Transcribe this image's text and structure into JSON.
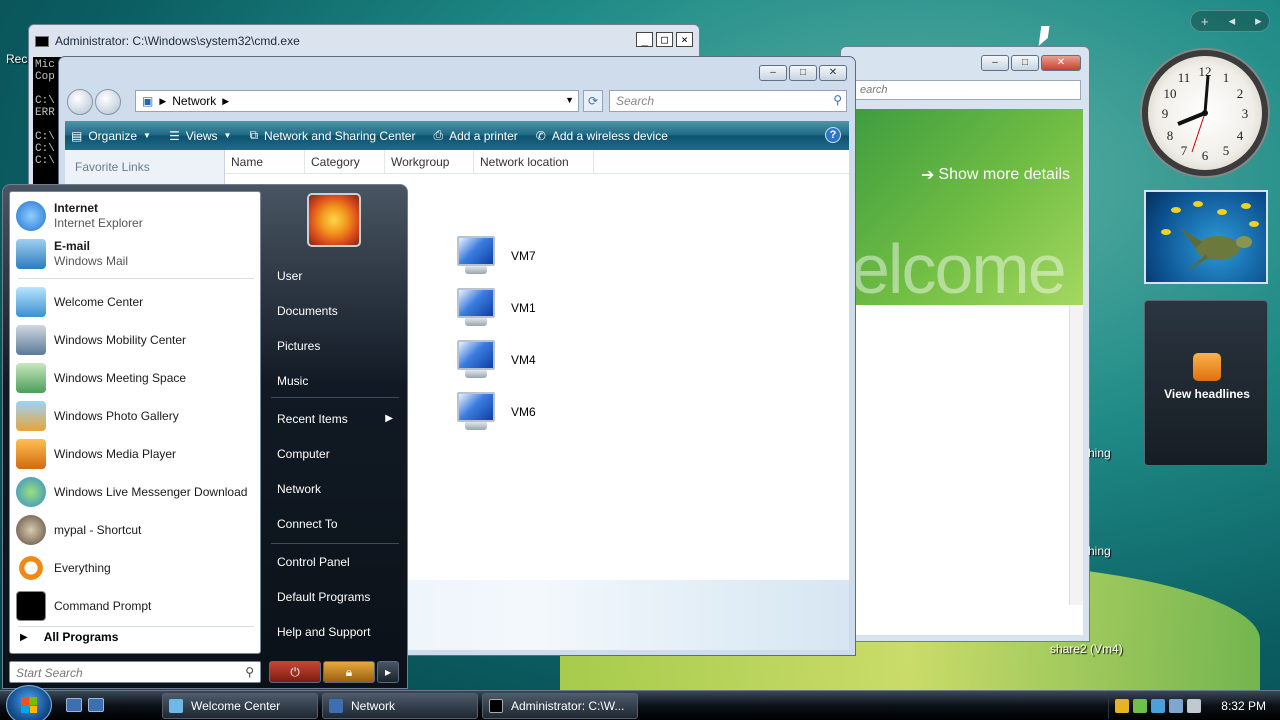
{
  "cmd": {
    "title": "Administrator: C:\\Windows\\system32\\cmd.exe",
    "lines": "Mic\nCop\n\nC:\\\nERR\n\nC:\\\nC:\\\nC:\\",
    "ctrl_min": "_",
    "ctrl_max": "□",
    "ctrl_close": "×"
  },
  "welcome_window": {
    "search_placeholder": "earch",
    "show_more_details": "Show more details",
    "banner_text": "elcome"
  },
  "explorer": {
    "address": "Network",
    "search_placeholder": "Search",
    "commands": [
      "Organize",
      "Views",
      "Network and Sharing Center",
      "Add a printer",
      "Add a wireless device"
    ],
    "help": "?",
    "favorite_links": "Favorite Links",
    "columns": [
      "Name",
      "Category",
      "Workgroup",
      "Network location"
    ],
    "items": [
      "VM7",
      "VM1",
      "VM4",
      "VM6"
    ]
  },
  "start_menu": {
    "pinned": [
      {
        "title": "Internet",
        "subtitle": "Internet Explorer"
      },
      {
        "title": "E-mail",
        "subtitle": "Windows Mail"
      }
    ],
    "recent": [
      "Welcome Center",
      "Windows Mobility Center",
      "Windows Meeting Space",
      "Windows Photo Gallery",
      "Windows Media Player",
      "Windows Live Messenger Download",
      "mypal - Shortcut",
      "Everything",
      "Command Prompt"
    ],
    "all_programs": "All Programs",
    "search_placeholder": "Start Search",
    "right_links": [
      "User",
      "Documents",
      "Pictures",
      "Music",
      "Recent Items",
      "Computer",
      "Network",
      "Connect To",
      "Control Panel",
      "Default Programs",
      "Help and Support"
    ]
  },
  "taskbar": {
    "tasks": [
      "Welcome Center",
      "Network",
      "Administrator: C:\\W..."
    ],
    "time": "8:32 PM"
  },
  "gadgets": {
    "feed_label": "View headlines"
  },
  "desktop_labels": {
    "label1": "hing",
    "label2": "hing",
    "label3": "share2 (Vm4)",
    "recycle": "Rec"
  },
  "colors": {
    "accent": "#1d6a84",
    "desktop": "#1f8a86"
  }
}
